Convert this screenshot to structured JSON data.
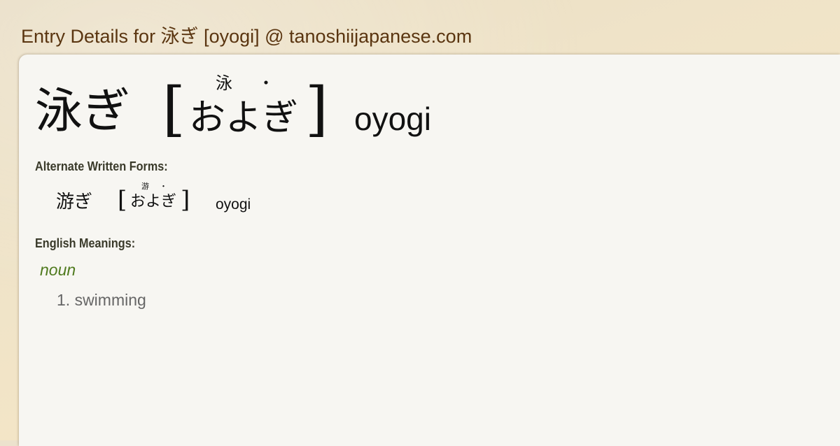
{
  "page_title": "Entry Details for 泳ぎ [oyogi] @ tanoshiijapanese.com",
  "entry": {
    "kanji": "泳ぎ",
    "bracket_open": "[",
    "bracket_close": "]",
    "reading": "およぎ",
    "ruby_kanji": "泳",
    "ruby_dot": "・",
    "romaji": "oyogi"
  },
  "alternate": {
    "label": "Alternate Written Forms:",
    "forms": [
      {
        "kanji": "游ぎ",
        "reading": "およぎ",
        "ruby_kanji": "游",
        "ruby_dot": "・",
        "romaji": "oyogi"
      }
    ]
  },
  "meanings": {
    "label": "English Meanings:",
    "part_of_speech": "noun",
    "items": [
      "1. swimming"
    ]
  },
  "colors": {
    "title": "#5a3510",
    "part_of_speech": "#4f7a1e",
    "meaning_text": "#666666"
  }
}
